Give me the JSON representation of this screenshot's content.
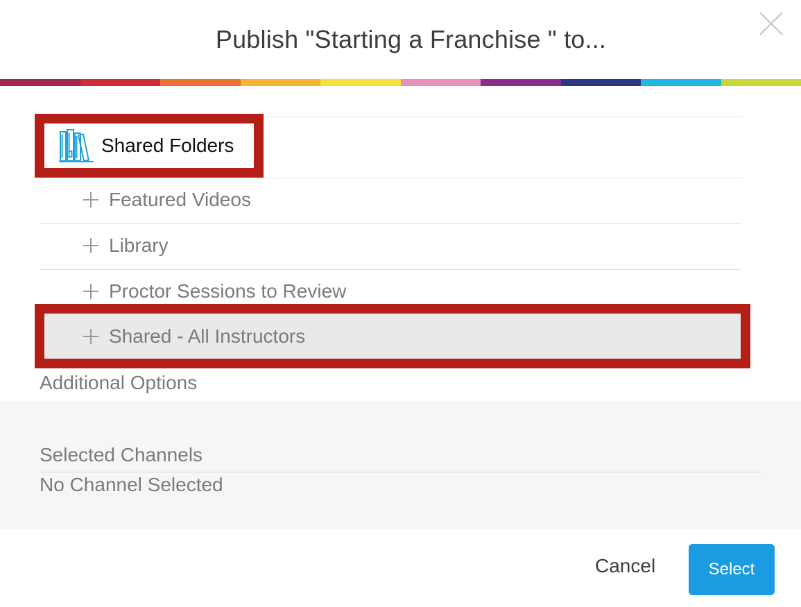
{
  "dialog": {
    "title": "Publish \"Starting a Franchise \" to..."
  },
  "rainbow_colors": [
    "#a0254f",
    "#d22b3a",
    "#ef7035",
    "#f7b334",
    "#f6e03f",
    "#e88fbe",
    "#8a2d8c",
    "#2f3587",
    "#21b6e6",
    "#c8d63c"
  ],
  "tree": {
    "root": {
      "label": "Shared Folders",
      "icon": "bookshelf-icon"
    },
    "folders": [
      {
        "label": "Featured Videos",
        "icon": "plus-icon"
      },
      {
        "label": "Library",
        "icon": "plus-icon"
      },
      {
        "label": "Proctor Sessions to Review",
        "icon": "plus-icon"
      },
      {
        "label": "Shared - All Instructors",
        "icon": "plus-icon",
        "selected": true
      }
    ]
  },
  "additional_options": {
    "label": "Additional Options"
  },
  "selected_channels": {
    "title": "Selected Channels",
    "empty_text": "No Channel Selected"
  },
  "footer": {
    "cancel_label": "Cancel",
    "select_label": "Select"
  },
  "colors": {
    "accent": "#1b9be1",
    "highlight_border": "#b31f16",
    "selected_row_bg": "#e9e9e9"
  }
}
